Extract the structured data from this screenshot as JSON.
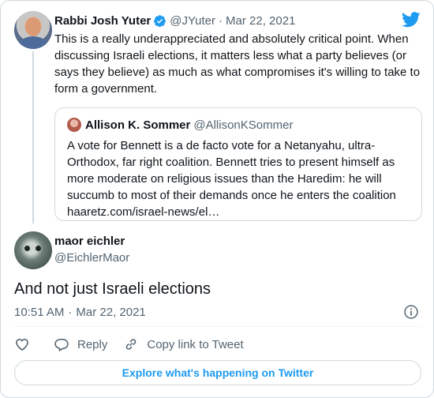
{
  "colors": {
    "accent": "#1d9bf0",
    "text_primary": "#0f1419",
    "text_secondary": "#536471",
    "border": "#cfd9de"
  },
  "icons": {
    "brand": "twitter-bird-icon",
    "verified": "verified-badge-icon",
    "info": "info-icon",
    "like": "heart-icon",
    "reply": "speech-bubble-icon",
    "copy_link": "link-icon"
  },
  "parent_tweet": {
    "author_name": "Rabbi Josh Yuter",
    "author_handle": "@JYuter",
    "separator": "·",
    "date": "Mar 22, 2021",
    "text": "This is a really underappreciated and absolutely critical point. When discussing Israeli elections, it matters less what a party believes (or says they believe) as much as what compromises it's willing to take to form a government.",
    "quoted_tweet": {
      "author_name": "Allison K. Sommer",
      "author_handle": "@AllisonKSommer",
      "text": "A vote for Bennett is a de facto vote for a Netanyahu, ultra-Orthodox, far right coalition. Bennett tries to present himself as more moderate on religious issues than the Haredim: he will succumb to most of their demands once he enters the coalition",
      "link": "haaretz.com/israel-news/el…"
    }
  },
  "main_tweet": {
    "author_name": "maor eichler",
    "author_handle": "@EichlerMaor",
    "text": "And not just Israeli elections",
    "time": "10:51 AM",
    "separator": "·",
    "date": "Mar 22, 2021"
  },
  "actions": {
    "reply_label": "Reply",
    "copy_link_label": "Copy link to Tweet"
  },
  "explore_label": "Explore what's happening on Twitter"
}
